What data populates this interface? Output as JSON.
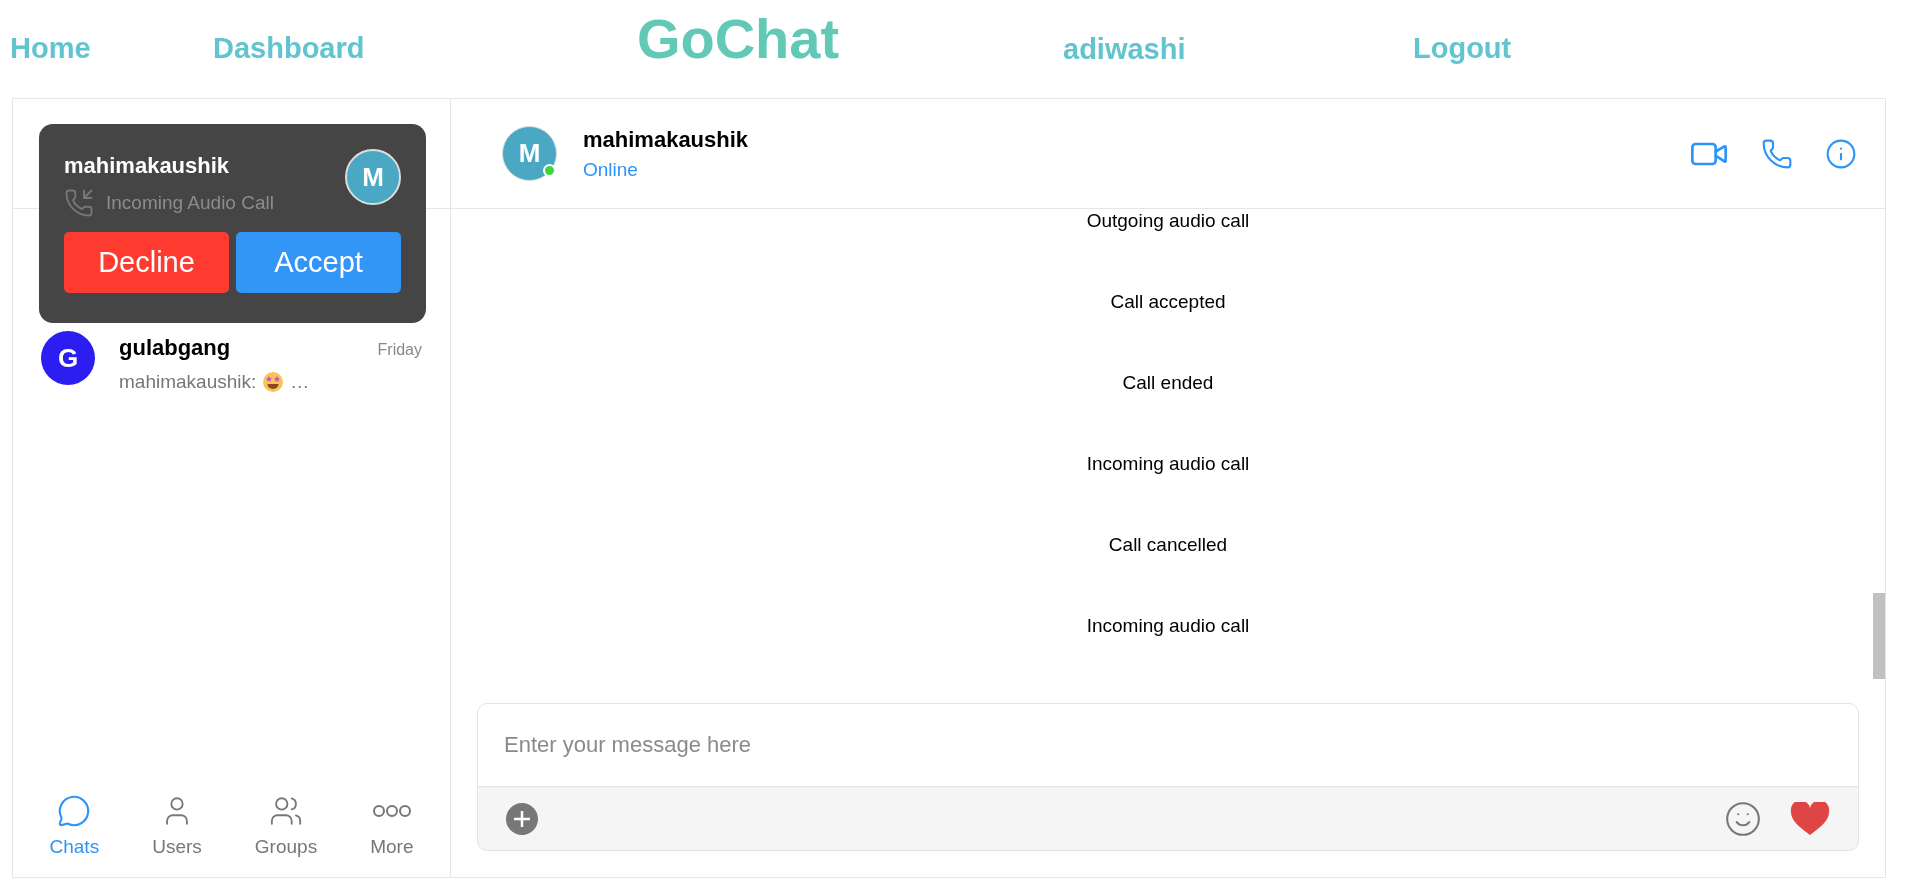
{
  "nav": [
    {
      "kind": "link",
      "label": "Home"
    },
    {
      "kind": "link",
      "label": "Dashboard"
    },
    {
      "kind": "brand",
      "label": "GoChat"
    },
    {
      "kind": "user",
      "label": "adiwashi"
    },
    {
      "kind": "link",
      "label": "Logout"
    }
  ],
  "call_popup": {
    "caller": "mahimakaushik",
    "status": "Incoming Audio Call",
    "avatar_letter": "M",
    "decline": "Decline",
    "accept": "Accept"
  },
  "chats": [
    {
      "avatar_letter": "G",
      "name": "gulabgang",
      "time": "Friday",
      "preview": "mahimakaushik:",
      "preview_end": "…"
    }
  ],
  "bottom_nav": [
    {
      "kind": "chat",
      "label": "Chats",
      "selected": true
    },
    {
      "kind": "user",
      "label": "Users",
      "selected": false
    },
    {
      "kind": "group",
      "label": "Groups",
      "selected": false
    },
    {
      "kind": "more",
      "label": "More",
      "selected": false
    }
  ],
  "conversation": {
    "avatar_letter": "M",
    "name": "mahimakaushik",
    "status": "Online",
    "online": true,
    "messages": [
      "Outgoing audio call",
      "Call accepted",
      "Call ended",
      "Incoming audio call",
      "Call cancelled",
      "Incoming audio call"
    ],
    "composer": {
      "placeholder": "Enter your message here"
    }
  }
}
